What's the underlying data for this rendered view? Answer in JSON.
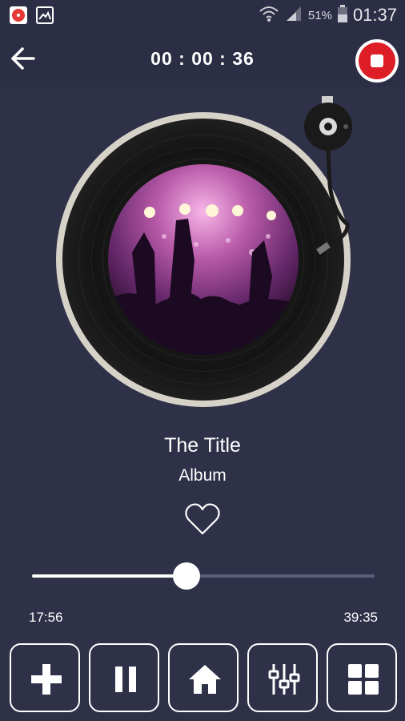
{
  "status_bar": {
    "battery_text": "51%",
    "clock": "01:37"
  },
  "header": {
    "timer": "00 : 00 : 36"
  },
  "track": {
    "title": "The Title",
    "album": "Album"
  },
  "playback": {
    "elapsed": "17:56",
    "total": "39:35",
    "progress_fraction": 0.45
  },
  "controls": [
    {
      "name": "add-button",
      "icon": "plus-icon"
    },
    {
      "name": "pause-button",
      "icon": "pause-icon"
    },
    {
      "name": "home-button",
      "icon": "home-icon"
    },
    {
      "name": "equalizer-button",
      "icon": "equalizer-icon"
    },
    {
      "name": "grid-button",
      "icon": "grid-icon"
    }
  ],
  "colors": {
    "background": "#2e3148",
    "stop_red": "#dd1e26",
    "record_rim": "#d7d2c8"
  }
}
